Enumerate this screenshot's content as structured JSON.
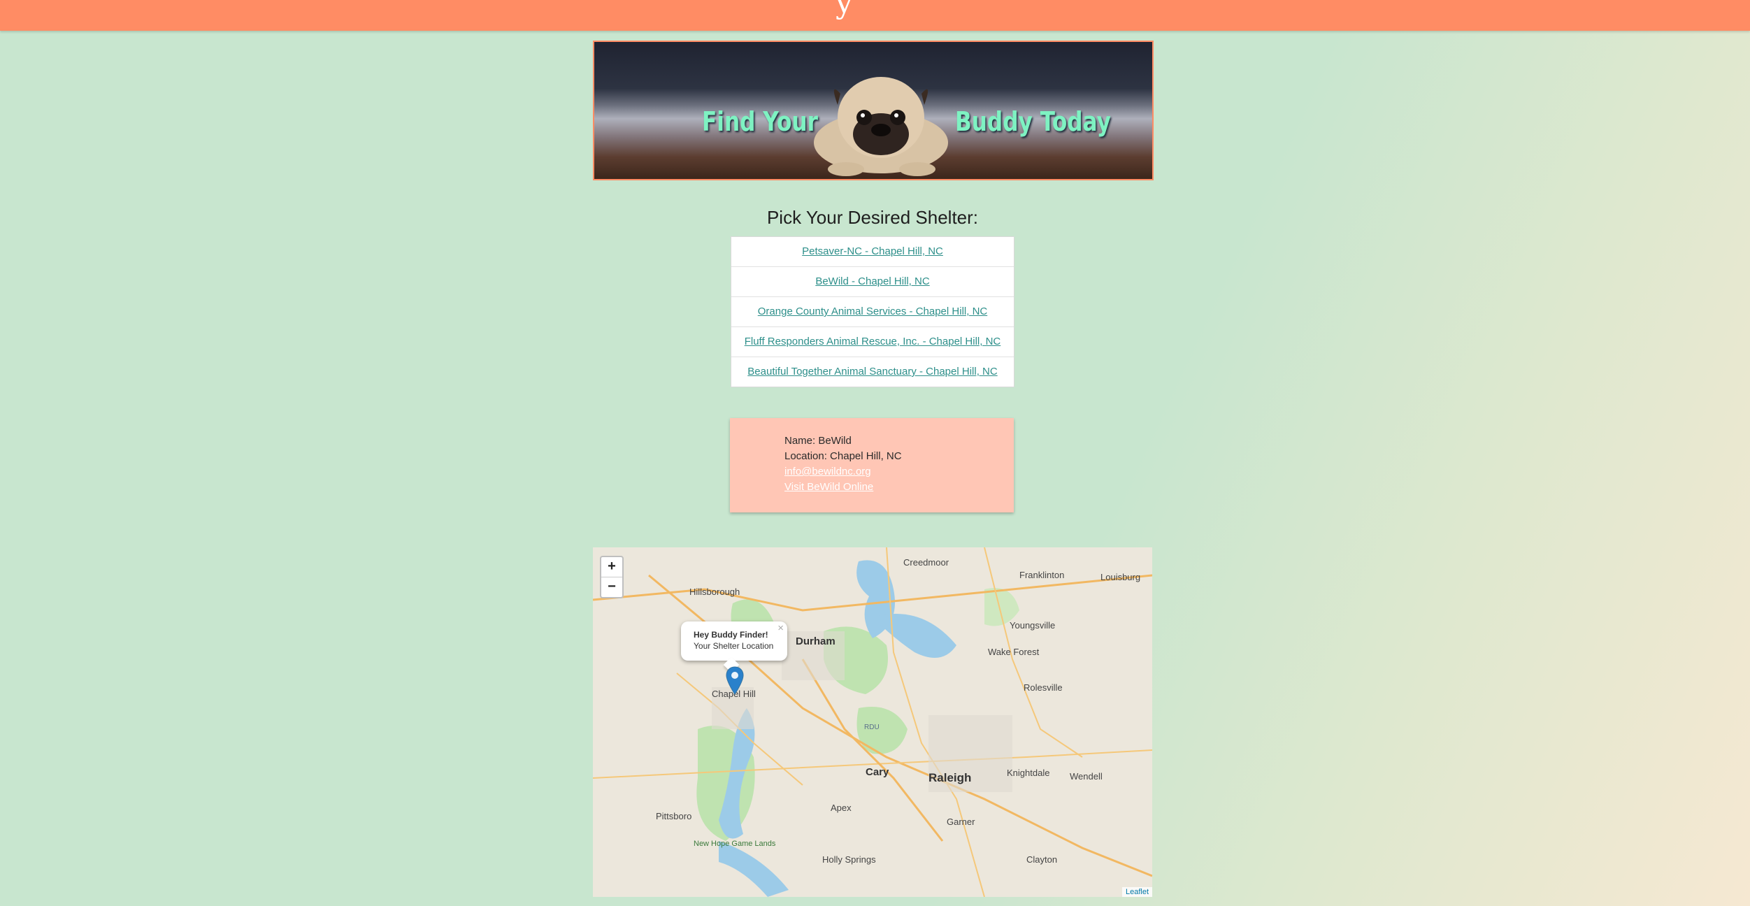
{
  "banner": {
    "left_text": "Find Your",
    "right_text": "Buddy Today"
  },
  "shelter_picker": {
    "title": "Pick Your Desired Shelter:",
    "options": [
      "Petsaver-NC - Chapel Hill, NC",
      "BeWild - Chapel Hill, NC",
      "Orange County Animal Services - Chapel Hill, NC",
      "Fluff Responders Animal Rescue, Inc. - Chapel Hill, NC",
      "Beautiful Together Animal Sanctuary - Chapel Hill, NC"
    ]
  },
  "shelter_info": {
    "name": "Name: BeWild",
    "location": "Location: Chapel Hill, NC",
    "email": "info@bewildnc.org",
    "website": "Visit BeWild Online"
  },
  "map": {
    "zoom_in": "+",
    "zoom_out": "−",
    "popup_title": "Hey Buddy Finder!",
    "popup_body": "Your Shelter Location",
    "popup_close": "×",
    "attribution": "Leaflet",
    "places": {
      "creedmoor": "Creedmoor",
      "franklinton": "Franklinton",
      "louisburg": "Louisburg",
      "hillsborough": "Hillsborough",
      "youngsville": "Youngsville",
      "durham": "Durham",
      "wake_forest": "Wake Forest",
      "rolesville": "Rolesville",
      "chapel_hill": "Chapel Hill",
      "rdu": "RDU",
      "cary": "Cary",
      "raleigh": "Raleigh",
      "knightdale": "Knightdale",
      "wendell": "Wendell",
      "apex": "Apex",
      "pittsboro": "Pittsboro",
      "garner": "Garner",
      "new_hope": "New Hope Game Lands",
      "holly_springs": "Holly Springs",
      "clayton": "Clayton"
    },
    "marker_icon": "map-pin-icon"
  },
  "colors": {
    "header": "#ff8c64",
    "background": "#c8e6cf",
    "card": "#ffc6b5",
    "link": "#2d8f8a",
    "banner_text": "#7ef2c2"
  }
}
